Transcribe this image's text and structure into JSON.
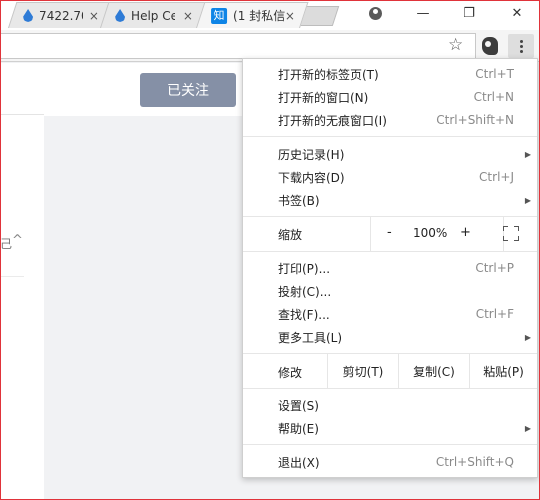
{
  "tabs": [
    {
      "title": "7422.70",
      "favicon": "drop-icon"
    },
    {
      "title": "Help Ce",
      "favicon": "drop-icon"
    },
    {
      "title": "(1 封私信",
      "favicon": "zhihu-icon",
      "favicon_text": "知",
      "active": true
    }
  ],
  "tab_close_glyph": "×",
  "window_controls": {
    "minimize": "—",
    "maximize": "❐",
    "close": "✕"
  },
  "page": {
    "follow_button": "已关注",
    "left_glyph": "己",
    "collapse_glyph": "^"
  },
  "menu": {
    "group1": [
      {
        "label": "打开新的标签页(T)",
        "shortcut": "Ctrl+T"
      },
      {
        "label": "打开新的窗口(N)",
        "shortcut": "Ctrl+N"
      },
      {
        "label": "打开新的无痕窗口(I)",
        "shortcut": "Ctrl+Shift+N"
      }
    ],
    "group2": [
      {
        "label": "历史记录(H)",
        "submenu": true
      },
      {
        "label": "下载内容(D)",
        "shortcut": "Ctrl+J"
      },
      {
        "label": "书签(B)",
        "submenu": true
      }
    ],
    "zoom": {
      "label": "缩放",
      "minus": "-",
      "value": "100%",
      "plus": "+"
    },
    "group3": [
      {
        "label": "打印(P)...",
        "shortcut": "Ctrl+P"
      },
      {
        "label": "投射(C)..."
      },
      {
        "label": "查找(F)...",
        "shortcut": "Ctrl+F"
      },
      {
        "label": "更多工具(L)",
        "submenu": true
      }
    ],
    "edit": {
      "label": "修改",
      "cut": "剪切(T)",
      "copy": "复制(C)",
      "paste": "粘贴(P)"
    },
    "group4": [
      {
        "label": "设置(S)"
      },
      {
        "label": "帮助(E)",
        "submenu": true
      }
    ],
    "exit": {
      "label": "退出(X)",
      "shortcut": "Ctrl+Shift+Q"
    },
    "submenu_arrow": "▶"
  }
}
